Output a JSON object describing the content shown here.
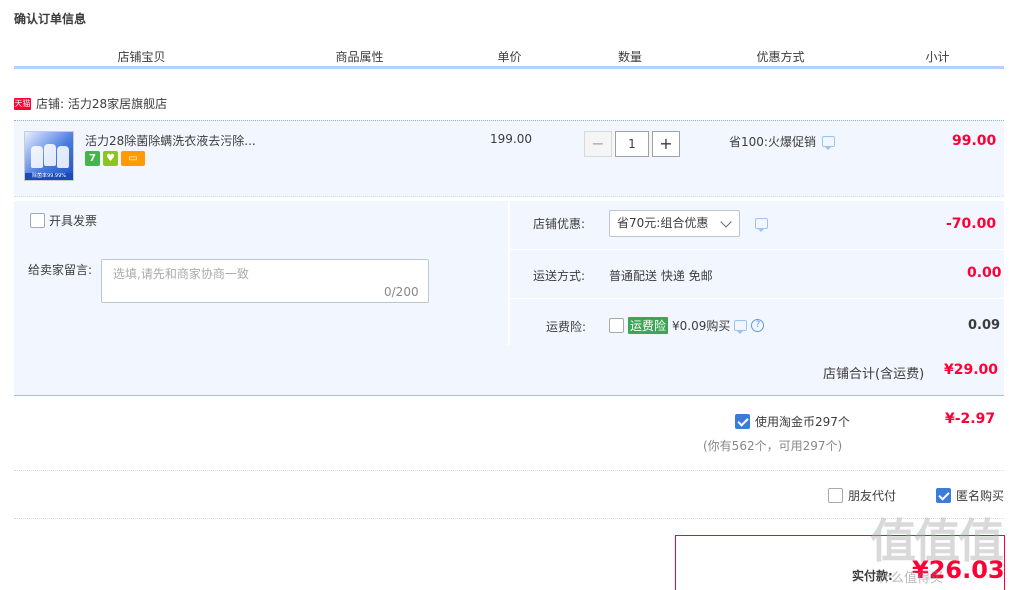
{
  "page_title": "确认订单信息",
  "columns": [
    "店铺宝贝",
    "商品属性",
    "单价",
    "数量",
    "优惠方式",
    "小计"
  ],
  "store": {
    "badge": "天猫",
    "label": "店铺: 活力28家居旗舰店"
  },
  "item": {
    "thumb_strip": "除菌率99.99%",
    "name": "活力28除菌除螨洗衣液去污除...",
    "svc_icons": [
      "7",
      "♥",
      "▭"
    ],
    "unit_price": "199.00",
    "quantity": "1",
    "minus": "−",
    "plus": "+",
    "promo": "省100:火爆促销",
    "subtotal": "99.00"
  },
  "invoice": {
    "label": "开具发票"
  },
  "message": {
    "label": "给卖家留言:",
    "placeholder": "选填,请先和商家协商一致",
    "counter": "0/200"
  },
  "store_discount": {
    "label": "店铺优惠:",
    "selected": "省70元:组合优惠",
    "amount": "-70.00"
  },
  "shipping": {
    "label": "运送方式:",
    "method": "普通配送 快递 免邮",
    "amount": "0.00"
  },
  "freight_insurance": {
    "label": "运费险:",
    "tag": "运费险",
    "price_text": "¥0.09购买",
    "help": "?",
    "amount": "0.09"
  },
  "store_total": {
    "label": "店铺合计(含运费)",
    "amount": "¥29.00"
  },
  "taojinbi": {
    "label": "使用淘金币297个",
    "detail": "(你有562个，可用297个)",
    "amount": "¥-2.97"
  },
  "friend_pay": {
    "label": "朋友代付"
  },
  "anonymous": {
    "label": "匿名购买"
  },
  "payment": {
    "label": "实付款:",
    "amount": "¥26.03"
  },
  "watermark": {
    "main": "值值值",
    "sub": "什么值得买"
  },
  "colors": {
    "accent_red": "#ff0036",
    "accent_blue": "#3b7bdc",
    "panel_bg": "#f2f7ff"
  }
}
